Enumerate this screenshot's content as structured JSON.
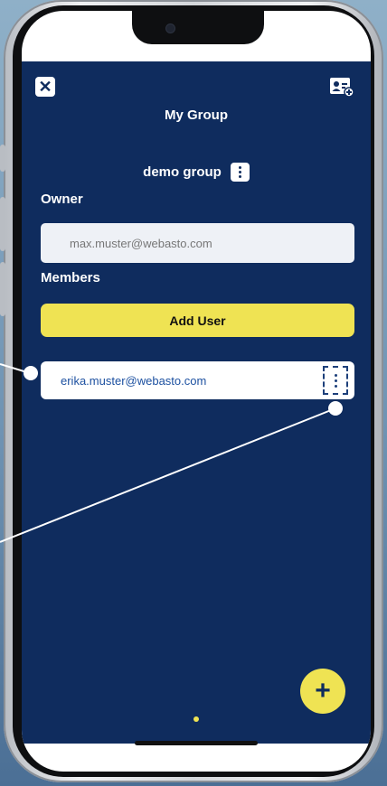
{
  "header": {
    "title": "My Group",
    "close_icon": "close-icon",
    "group_add_icon": "add-contact-card-icon"
  },
  "group": {
    "name": "demo group",
    "menu_icon": "kebab-menu-icon"
  },
  "owner": {
    "label": "Owner",
    "email": "max.muster@webasto.com"
  },
  "members": {
    "label": "Members",
    "add_button_label": "Add User",
    "items": [
      {
        "email": "erika.muster@webasto.com",
        "menu_icon": "kebab-menu-icon"
      }
    ]
  },
  "fab": {
    "label": "+",
    "icon": "plus-icon"
  },
  "colors": {
    "app_background": "#0f2c5e",
    "accent_yellow": "#efe353",
    "member_email": "#1c50a0"
  }
}
